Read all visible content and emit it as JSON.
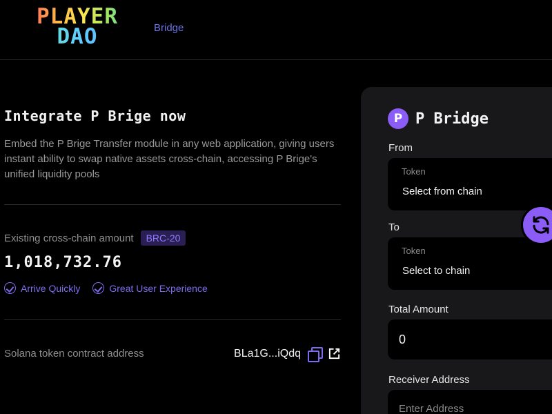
{
  "header": {
    "logo_line1": "PLAYER",
    "logo_line2": "DAO",
    "nav_bridge": "Bridge"
  },
  "intro": {
    "title": "Integrate P Brige now",
    "description": "Embed the P Brige Transfer module in any web application, giving users instant ability to swap native assets cross-chain, accessing P Brige's unified liquidity pools"
  },
  "stats": {
    "label": "Existing cross-chain amount",
    "badge": "BRC-20",
    "amount": "1,018,732.76",
    "features": [
      "Arrive Quickly",
      "Great User Experience"
    ]
  },
  "contract": {
    "label": "Solana token contract address",
    "address": "BLa1G...iQdq"
  },
  "bridge_panel": {
    "logo_letter": "P",
    "title": "P Bridge",
    "from_label": "From",
    "from_token_label": "Token",
    "from_select": "Select from chain",
    "to_label": "To",
    "to_token_label": "Token",
    "to_select": "Select to chain",
    "total_amount_label": "Total Amount",
    "total_amount_value": "0",
    "receiver_label": "Receiver Address",
    "receiver_placeholder": "Enter Address"
  },
  "colors": {
    "accent": "#7c6cf0",
    "button": "#8b5cf6",
    "panel_bg": "#18181b",
    "badge_bg": "#2a1e52"
  }
}
